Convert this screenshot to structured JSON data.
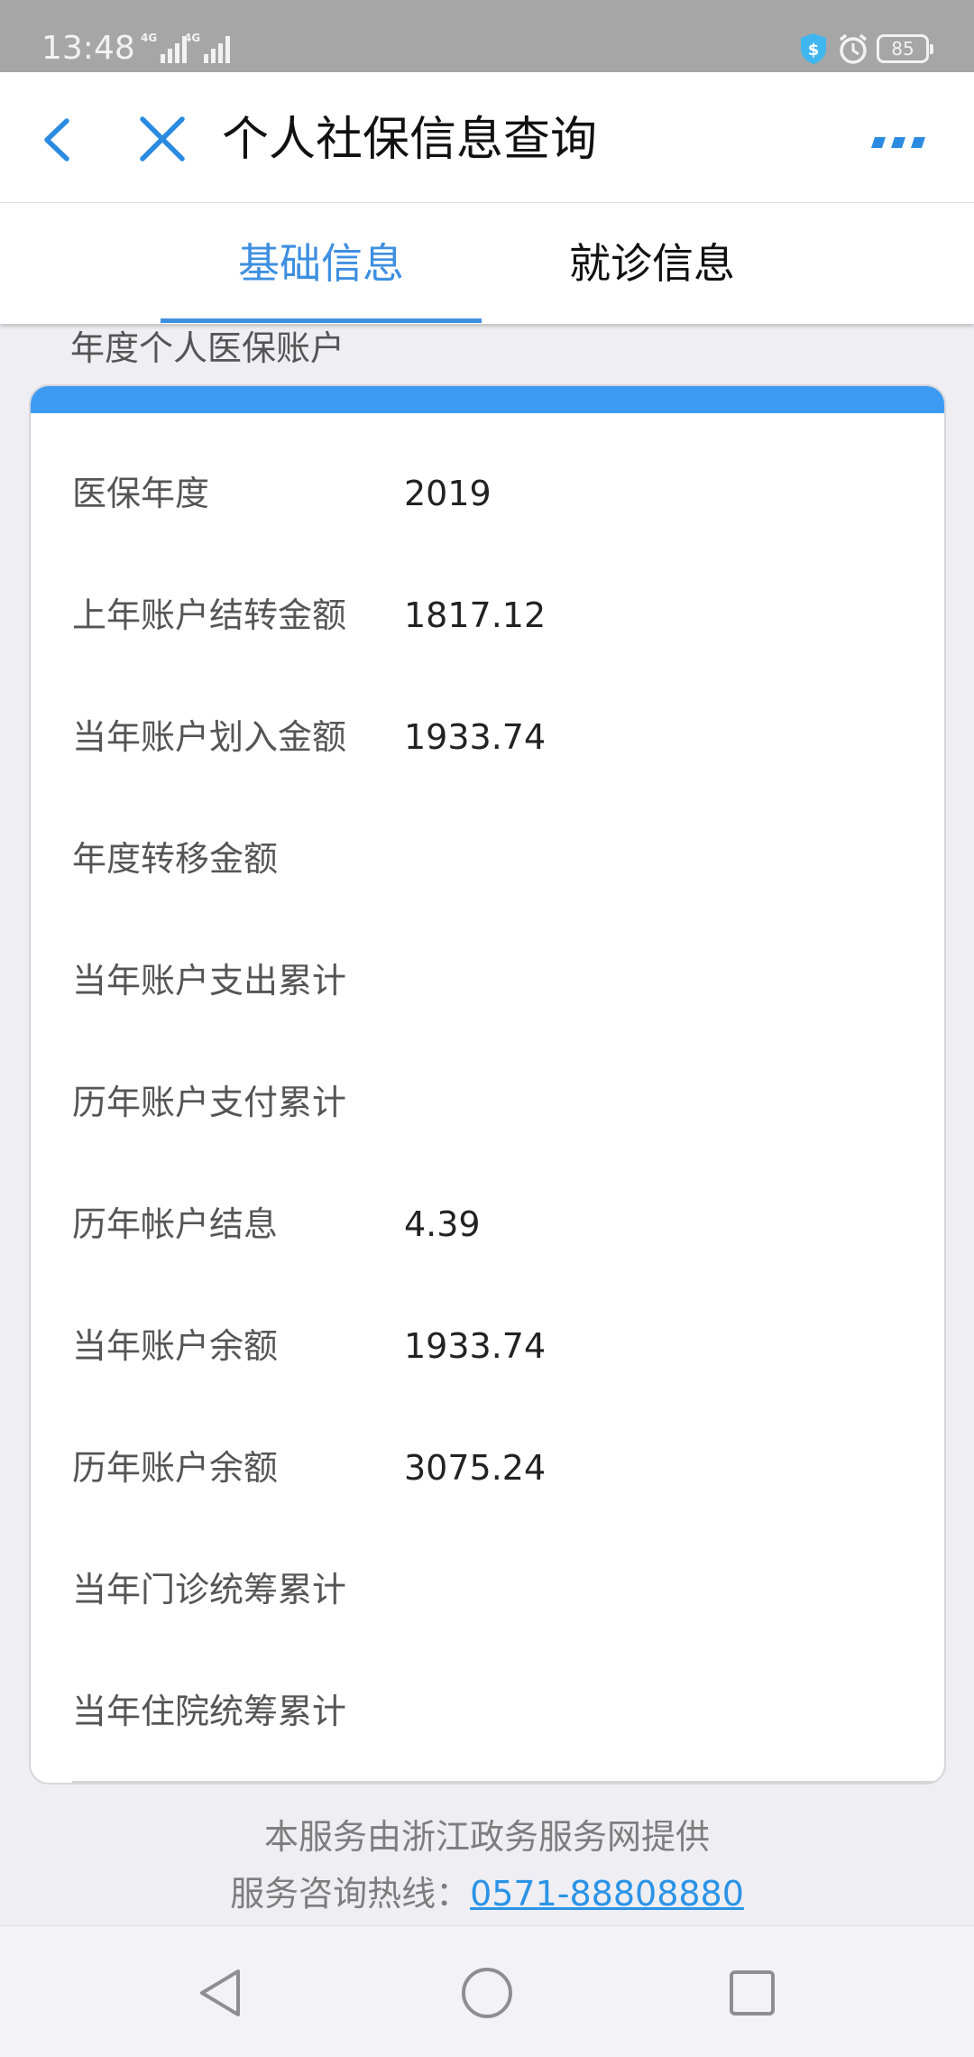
{
  "status_bar": {
    "time": "13:48",
    "signal_1_label": "4G",
    "signal_2_label": "4G",
    "battery": "85",
    "icons": [
      "signal-icon",
      "signal-icon",
      "shield-dollar-icon",
      "alarm-icon",
      "battery-icon"
    ]
  },
  "header": {
    "title": "个人社保信息查询",
    "back_icon": "chevron-left-icon",
    "close_icon": "close-icon",
    "more_icon": "more-icon"
  },
  "tabs": [
    {
      "label": "基础信息",
      "active": true
    },
    {
      "label": "就诊信息",
      "active": false
    }
  ],
  "section": {
    "heading": "年度个人医保账户",
    "rows": [
      {
        "label": "医保年度",
        "value": "2019"
      },
      {
        "label": "上年账户结转金额",
        "value": "1817.12"
      },
      {
        "label": "当年账户划入金额",
        "value": "1933.74"
      },
      {
        "label": "年度转移金额",
        "value": ""
      },
      {
        "label": "当年账户支出累计",
        "value": ""
      },
      {
        "label": "历年账户支付累计",
        "value": ""
      },
      {
        "label": "历年帐户结息",
        "value": "4.39"
      },
      {
        "label": "当年账户余额",
        "value": "1933.74"
      },
      {
        "label": "历年账户余额",
        "value": "3075.24"
      },
      {
        "label": "当年门诊统筹累计",
        "value": ""
      },
      {
        "label": "当年住院统筹累计",
        "value": ""
      }
    ]
  },
  "footer": {
    "provider": "本服务由浙江政务服务网提供",
    "hotline_label": "服务咨询热线：",
    "hotline_number": "0571-88808880"
  },
  "nav_bar": {
    "icons": [
      "back-triangle-icon",
      "home-circle-icon",
      "recents-square-icon"
    ]
  },
  "colors": {
    "accent": "#3d8fe0",
    "card_bar": "#3d9af2",
    "link": "#2a93e6",
    "status_bar": "#a6a6a6"
  }
}
